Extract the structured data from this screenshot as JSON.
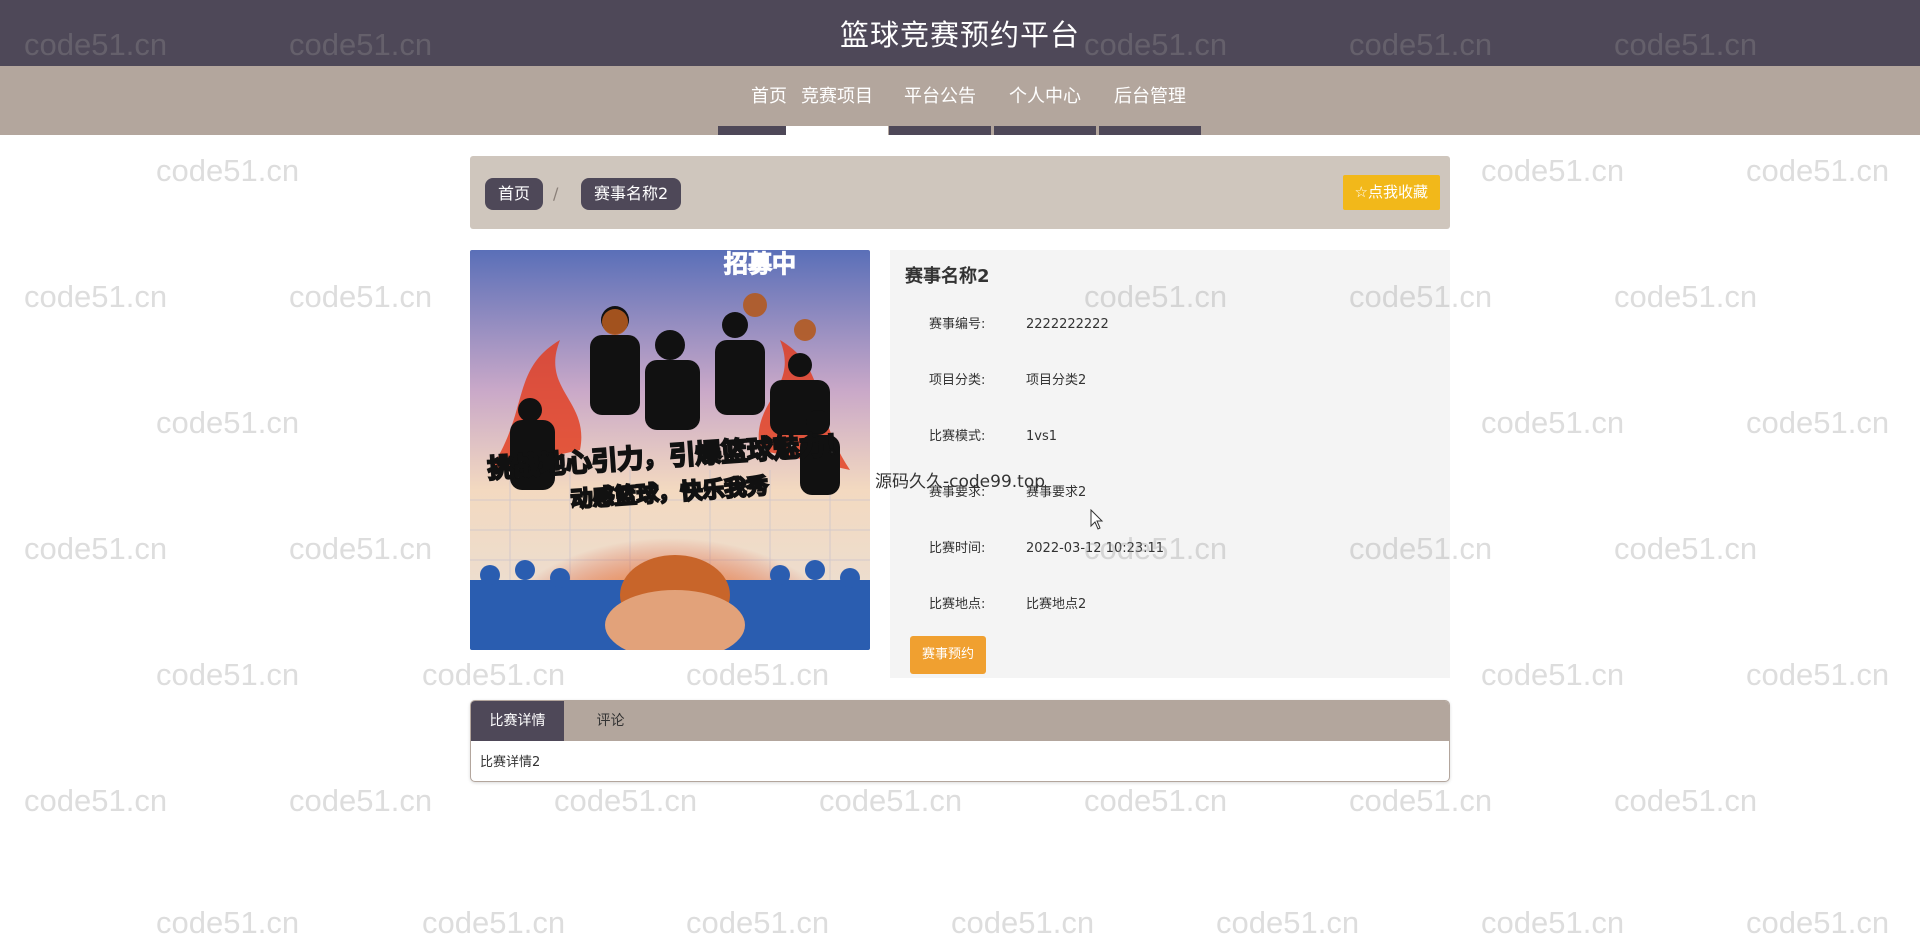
{
  "header": {
    "title": "篮球竞赛预约平台"
  },
  "nav": {
    "items": [
      {
        "label": "首页"
      },
      {
        "label": "竞赛项目"
      },
      {
        "label": "平台公告"
      },
      {
        "label": "个人中心"
      },
      {
        "label": "后台管理"
      }
    ],
    "active": "竞赛项目"
  },
  "breadcrumb": {
    "home": "首页",
    "separator": "/",
    "current": "赛事名称2"
  },
  "favorite": {
    "label": "☆点我收藏"
  },
  "poster": {
    "top_text": "招募中",
    "line1": "挑战地心引力，引爆篮球魅力！",
    "line2": "动感篮球，快乐我秀"
  },
  "detail": {
    "name": "赛事名称2",
    "fields": [
      {
        "label": "赛事编号:",
        "value": "2222222222"
      },
      {
        "label": "项目分类:",
        "value": "项目分类2"
      },
      {
        "label": "比赛模式:",
        "value": "1vs1"
      },
      {
        "label": "赛事要求:",
        "value": "赛事要求2"
      },
      {
        "label": "比赛时间:",
        "value": "2022-03-12 10:23:11"
      },
      {
        "label": "比赛地点:",
        "value": "比赛地点2"
      }
    ],
    "book_label": "赛事预约"
  },
  "tabs": {
    "items": [
      {
        "label": "比赛详情"
      },
      {
        "label": "评论"
      }
    ],
    "active": "比赛详情",
    "content": "比赛详情2"
  },
  "watermark": {
    "text": "code51.cn",
    "overlay": "源码久久-code99.top"
  },
  "colors": {
    "header_bg": "#4e4858",
    "nav_bg": "#b3a69d",
    "crumb_bg": "#cfc6bd",
    "favorite_bg": "#f2b81a",
    "book_bg": "#f0a030",
    "panel_bg": "#f4f4f4"
  }
}
